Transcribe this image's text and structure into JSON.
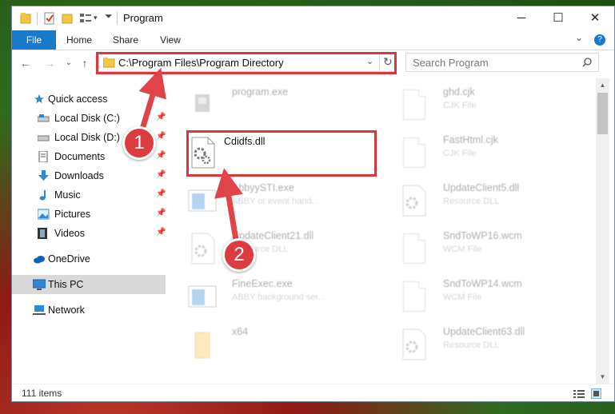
{
  "window": {
    "title": "Program",
    "minimize": "─",
    "maximize": "☐",
    "close": "✕"
  },
  "ribbon": {
    "tabs": [
      "File",
      "Home",
      "Share",
      "View"
    ],
    "collapse": "⌄",
    "help": "?"
  },
  "nav": {
    "back": "←",
    "forward": "→",
    "recent": "⌄",
    "up": "↑",
    "address": "C:\\Program Files\\Program Directory",
    "search_placeholder": "Search Program"
  },
  "sidebar": {
    "items": [
      {
        "label": "Quick access",
        "icon": "star-icon",
        "pinned": false
      },
      {
        "label": "Local Disk (C:)",
        "icon": "drive-icon",
        "pinned": true
      },
      {
        "label": "Local Disk (D:)",
        "icon": "drive-icon",
        "pinned": true
      },
      {
        "label": "Documents",
        "icon": "documents-icon",
        "pinned": true
      },
      {
        "label": "Downloads",
        "icon": "download-icon",
        "pinned": true
      },
      {
        "label": "Music",
        "icon": "music-icon",
        "pinned": true
      },
      {
        "label": "Pictures",
        "icon": "pictures-icon",
        "pinned": true
      },
      {
        "label": "Videos",
        "icon": "videos-icon",
        "pinned": true
      },
      {
        "label": "OneDrive",
        "icon": "cloud-icon",
        "pinned": false
      },
      {
        "label": "This PC",
        "icon": "computer-icon",
        "pinned": false,
        "selected": true
      },
      {
        "label": "Network",
        "icon": "network-icon",
        "pinned": false
      }
    ]
  },
  "files": {
    "left": [
      {
        "name": "program.exe",
        "type": "",
        "icon": "exe-icon"
      },
      {
        "name": "Cdidfs.dll",
        "type": "",
        "icon": "dll-gear-icon"
      },
      {
        "name": "AbbyySTI.exe",
        "type": "ABBY or event hand...",
        "icon": "exe-window-icon"
      },
      {
        "name": "UpdateClient21.dll",
        "type": "Resource DLL",
        "icon": "dll-gear-icon"
      },
      {
        "name": "FineExec.exe",
        "type": "ABBY background ser...",
        "icon": "exe-window-icon"
      },
      {
        "name": "x64",
        "type": "",
        "icon": "folder-icon"
      }
    ],
    "right": [
      {
        "name": "ghd.cjk",
        "type": "CJK File",
        "icon": "file-icon"
      },
      {
        "name": "FastHtml.cjk",
        "type": "CJK File",
        "icon": "file-icon"
      },
      {
        "name": "UpdateClient5.dll",
        "type": "Resource DLL",
        "icon": "dll-gear-icon"
      },
      {
        "name": "SndToWP16.wcm",
        "type": "WCM File",
        "icon": "file-icon"
      },
      {
        "name": "SndToWP14.wcm",
        "type": "WCM File",
        "icon": "file-icon"
      },
      {
        "name": "UpdateClient63.dll",
        "type": "Resource DLL",
        "icon": "dll-gear-icon"
      }
    ]
  },
  "status": {
    "item_count": "111 items"
  },
  "callouts": [
    "1",
    "2"
  ],
  "colors": {
    "accent": "#1979ca",
    "highlight": "#d9363e"
  }
}
